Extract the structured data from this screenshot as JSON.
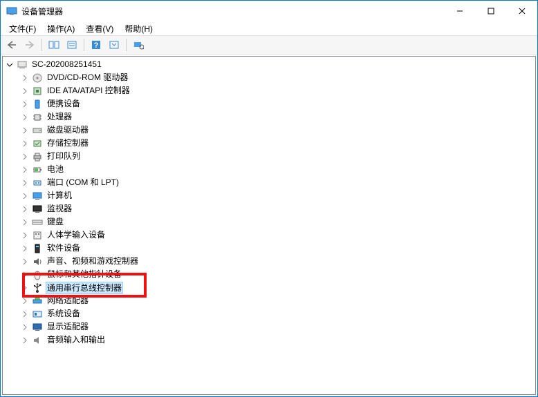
{
  "window": {
    "title": "设备管理器"
  },
  "menubar": {
    "file": "文件(F)",
    "action": "操作(A)",
    "view": "查看(V)",
    "help": "帮助(H)"
  },
  "tree": {
    "root": "SC-202008251451",
    "items": [
      {
        "label": "DVD/CD-ROM 驱动器",
        "icon": "disc"
      },
      {
        "label": "IDE ATA/ATAPI 控制器",
        "icon": "chip"
      },
      {
        "label": "便携设备",
        "icon": "portable"
      },
      {
        "label": "处理器",
        "icon": "cpu"
      },
      {
        "label": "磁盘驱动器",
        "icon": "hdd"
      },
      {
        "label": "存储控制器",
        "icon": "storage"
      },
      {
        "label": "打印队列",
        "icon": "printer"
      },
      {
        "label": "电池",
        "icon": "battery"
      },
      {
        "label": "端口 (COM 和 LPT)",
        "icon": "port"
      },
      {
        "label": "计算机",
        "icon": "computer"
      },
      {
        "label": "监视器",
        "icon": "monitor"
      },
      {
        "label": "键盘",
        "icon": "keyboard"
      },
      {
        "label": "人体学输入设备",
        "icon": "hid"
      },
      {
        "label": "软件设备",
        "icon": "software"
      },
      {
        "label": "声音、视频和游戏控制器",
        "icon": "audio"
      },
      {
        "label": "鼠标和其他指针设备",
        "icon": "mouse"
      },
      {
        "label": "通用串行总线控制器",
        "icon": "usb",
        "selected": true,
        "redbox": true
      },
      {
        "label": "网络适配器",
        "icon": "network"
      },
      {
        "label": "系统设备",
        "icon": "system"
      },
      {
        "label": "显示适配器",
        "icon": "display"
      },
      {
        "label": "音频输入和输出",
        "icon": "audioio"
      }
    ]
  }
}
